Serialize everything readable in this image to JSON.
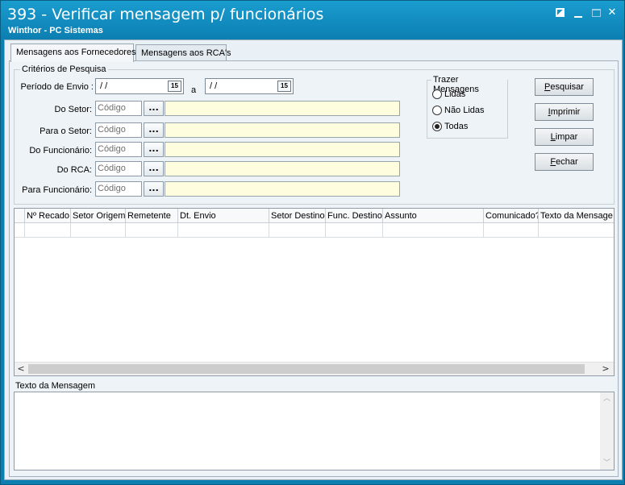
{
  "window": {
    "title": "393 - Verificar mensagem p/ funcionários",
    "subtitle": "Winthor - PC Sistemas"
  },
  "tabs": [
    {
      "label": "Mensagens aos Fornecedores",
      "active": true
    },
    {
      "label": "Mensagens aos RCA's",
      "active": false
    }
  ],
  "criteria": {
    "legend": "Critérios de Pesquisa",
    "periodo_label": "Período de Envio :",
    "date_from": " / /",
    "date_to": " / /",
    "date_sep": "a",
    "calendar_glyph": "15",
    "fields": [
      {
        "label": "Do Setor:",
        "placeholder": "Código"
      },
      {
        "label": "Para o Setor:",
        "placeholder": "Código"
      },
      {
        "label": "Do Funcionário:",
        "placeholder": "Código"
      },
      {
        "label": "Do RCA:",
        "placeholder": "Código"
      },
      {
        "label": "Para Funcionário:",
        "placeholder": "Código"
      }
    ],
    "dots_label": "..."
  },
  "trazer": {
    "legend": "Trazer Mensagens",
    "options": [
      {
        "label": "Lidas",
        "selected": false
      },
      {
        "label": "Não Lidas",
        "selected": false
      },
      {
        "label": "Todas",
        "selected": true
      }
    ]
  },
  "buttons": {
    "pesquisar_first": "P",
    "pesquisar_rest": "esquisar",
    "imprimir_first": "I",
    "imprimir_rest": "mprimir",
    "limpar_first": "L",
    "limpar_rest": "impar",
    "fechar_first": "F",
    "fechar_rest": "echar"
  },
  "grid": {
    "columns": [
      "Nº Recado",
      "Setor Origem",
      "Remetente",
      "Dt. Envio",
      "Setor Destino",
      "Func. Destino",
      "Assunto",
      "Comunicado?",
      "Texto da Mensage"
    ]
  },
  "message": {
    "label": "Texto da Mensagem"
  },
  "colors": {
    "title_bar": "#0c7fb2",
    "description_field": "#fefedf"
  }
}
